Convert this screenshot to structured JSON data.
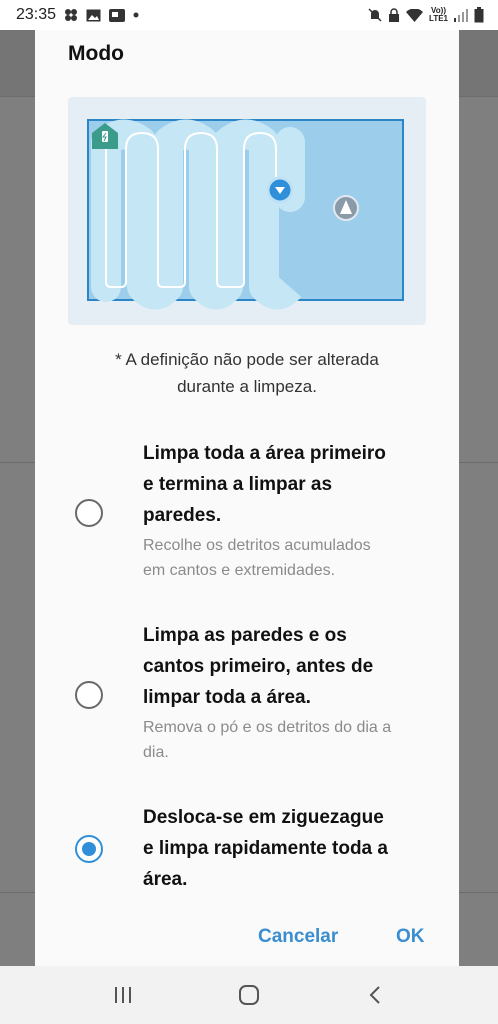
{
  "status_bar": {
    "time": "23:35",
    "volte_label": "Vo))",
    "lte_label": "LTE1"
  },
  "dialog": {
    "title": "Modo",
    "note_line1": "* A definição não pode ser alterada",
    "note_line2": "durante a limpeza.",
    "options": [
      {
        "title_lines": [
          "Limpa toda a área primeiro",
          "e termina a limpar as",
          "paredes."
        ],
        "desc_lines": [
          "Recolhe os detritos acumulados",
          "em cantos e extremidades."
        ],
        "selected": false
      },
      {
        "title_lines": [
          "Limpa as paredes e os",
          "cantos primeiro, antes de",
          "limpar toda a área."
        ],
        "desc_lines": [
          "Remova o pó e os detritos do dia a",
          "dia."
        ],
        "selected": false
      },
      {
        "title_lines": [
          "Desloca-se em ziguezague",
          "e limpa rapidamente toda a",
          "área."
        ],
        "desc_lines": [],
        "selected": true
      }
    ],
    "cancel_label": "Cancelar",
    "ok_label": "OK"
  },
  "colors": {
    "accent": "#2f8fd8",
    "map_fill": "#9ccdeb",
    "dock": "#3b9c8c"
  },
  "icons": {
    "status": [
      "pinwheel-icon",
      "image-icon",
      "cast-icon",
      "dot-icon",
      "mute-icon",
      "lock-icon",
      "wifi-icon",
      "signal-icon",
      "battery-icon"
    ],
    "nav": [
      "recents-icon",
      "home-icon",
      "back-icon"
    ]
  }
}
